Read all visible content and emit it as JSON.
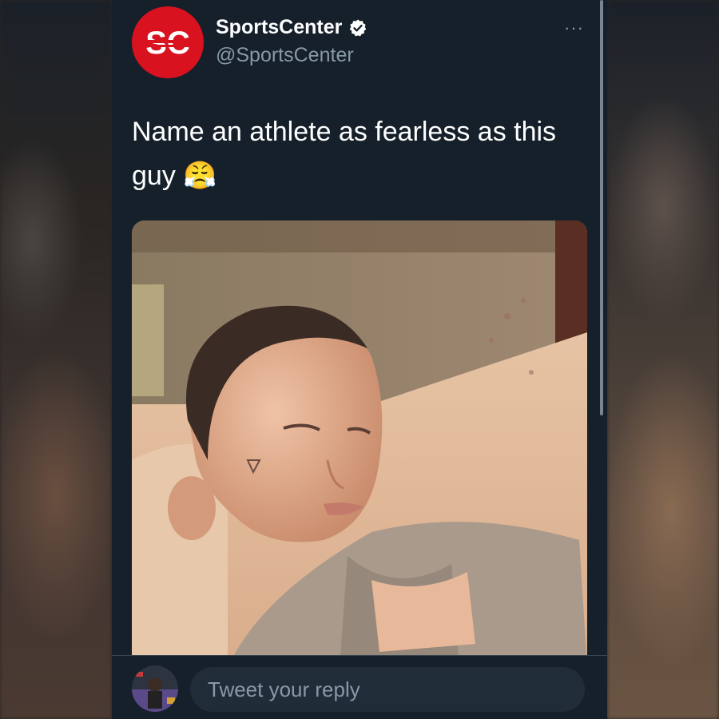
{
  "tweet": {
    "display_name": "SportsCenter",
    "handle": "@SportsCenter",
    "verified": true,
    "more_label": "···",
    "text": "Name an athlete as fearless as this guy 😤",
    "avatar_logo_text": "SC",
    "brand_color": "#d8121f"
  },
  "reply": {
    "placeholder": "Tweet your reply"
  },
  "theme": {
    "background": "#15202b",
    "secondary_text": "#8899a6",
    "primary_text": "#ffffff"
  },
  "icons": [
    "verified-badge-icon",
    "more-options-icon"
  ]
}
